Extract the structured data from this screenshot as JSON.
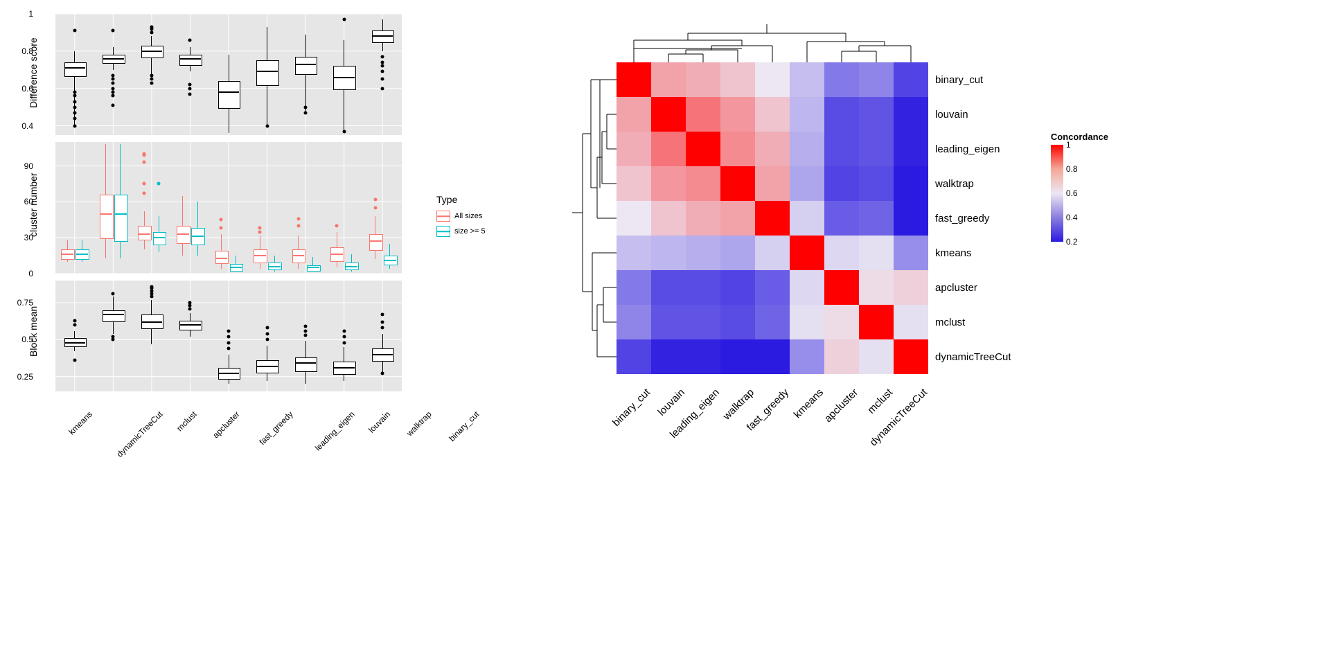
{
  "chart_data": [
    {
      "type": "boxplot",
      "ylabel": "Difference score",
      "ylim": [
        0.35,
        1.0
      ],
      "yticks": [
        0.4,
        0.6,
        0.8,
        1.0
      ],
      "categories": [
        "kmeans",
        "dynamicTreeCut",
        "mclust",
        "apcluster",
        "fast_greedy",
        "leading_eigen",
        "louvain",
        "walktrap",
        "binary_cut"
      ],
      "series": [
        {
          "name": "",
          "color": "#000",
          "stats": [
            {
              "min": 0.4,
              "q1": 0.67,
              "med": 0.71,
              "q3": 0.74,
              "max": 0.8,
              "out": [
                0.4,
                0.44,
                0.47,
                0.5,
                0.53,
                0.56,
                0.58,
                0.91
              ]
            },
            {
              "min": 0.7,
              "q1": 0.74,
              "med": 0.76,
              "q3": 0.78,
              "max": 0.82,
              "out": [
                0.51,
                0.56,
                0.58,
                0.6,
                0.63,
                0.65,
                0.67,
                0.91
              ]
            },
            {
              "min": 0.67,
              "q1": 0.77,
              "med": 0.8,
              "q3": 0.83,
              "max": 0.88,
              "out": [
                0.63,
                0.65,
                0.67,
                0.9,
                0.92,
                0.93
              ]
            },
            {
              "min": 0.69,
              "q1": 0.73,
              "med": 0.76,
              "q3": 0.78,
              "max": 0.82,
              "out": [
                0.57,
                0.6,
                0.62,
                0.86
              ]
            },
            {
              "min": 0.36,
              "q1": 0.5,
              "med": 0.58,
              "q3": 0.64,
              "max": 0.78,
              "out": []
            },
            {
              "min": 0.4,
              "q1": 0.62,
              "med": 0.69,
              "q3": 0.75,
              "max": 0.93,
              "out": [
                0.4
              ]
            },
            {
              "min": 0.47,
              "q1": 0.68,
              "med": 0.73,
              "q3": 0.77,
              "max": 0.89,
              "out": [
                0.47,
                0.5
              ]
            },
            {
              "min": 0.37,
              "q1": 0.6,
              "med": 0.66,
              "q3": 0.72,
              "max": 0.86,
              "out": [
                0.37,
                0.97
              ]
            },
            {
              "min": 0.8,
              "q1": 0.85,
              "med": 0.88,
              "q3": 0.91,
              "max": 0.97,
              "out": [
                0.6,
                0.65,
                0.69,
                0.72,
                0.74,
                0.77
              ]
            }
          ]
        }
      ]
    },
    {
      "type": "boxplot",
      "ylabel": "cluster number",
      "ylim": [
        0,
        110
      ],
      "yticks": [
        0,
        30,
        60,
        90
      ],
      "categories": [
        "kmeans",
        "dynamicTreeCut",
        "mclust",
        "apcluster",
        "fast_greedy",
        "leading_eigen",
        "louvain",
        "walktrap",
        "binary_cut"
      ],
      "legend_title": "Type",
      "series": [
        {
          "name": "All sizes",
          "color": "#F8766D",
          "stats": [
            {
              "min": 10,
              "q1": 13,
              "med": 16,
              "q3": 20,
              "max": 28,
              "out": []
            },
            {
              "min": 13,
              "q1": 30,
              "med": 50,
              "q3": 66,
              "max": 108,
              "out": []
            },
            {
              "min": 20,
              "q1": 29,
              "med": 33,
              "q3": 40,
              "max": 52,
              "out": [
                67,
                75,
                93,
                99,
                100
              ]
            },
            {
              "min": 15,
              "q1": 26,
              "med": 33,
              "q3": 40,
              "max": 65,
              "out": []
            },
            {
              "min": 4,
              "q1": 9,
              "med": 13,
              "q3": 19,
              "max": 33,
              "out": [
                38,
                45
              ]
            },
            {
              "min": 4,
              "q1": 10,
              "med": 15,
              "q3": 20,
              "max": 32,
              "out": [
                35,
                38
              ]
            },
            {
              "min": 4,
              "q1": 10,
              "med": 15,
              "q3": 20,
              "max": 32,
              "out": [
                40,
                46
              ]
            },
            {
              "min": 5,
              "q1": 11,
              "med": 16,
              "q3": 22,
              "max": 35,
              "out": [
                40
              ]
            },
            {
              "min": 12,
              "q1": 20,
              "med": 27,
              "q3": 33,
              "max": 48,
              "out": [
                55,
                62
              ]
            }
          ]
        },
        {
          "name": "size >= 5",
          "color": "#00BFC4",
          "stats": [
            {
              "min": 10,
              "q1": 13,
              "med": 16,
              "q3": 20,
              "max": 28,
              "out": []
            },
            {
              "min": 13,
              "q1": 28,
              "med": 50,
              "q3": 66,
              "max": 108,
              "out": []
            },
            {
              "min": 18,
              "q1": 25,
              "med": 30,
              "q3": 35,
              "max": 48,
              "out": [
                75
              ]
            },
            {
              "min": 15,
              "q1": 25,
              "med": 31,
              "q3": 38,
              "max": 60,
              "out": []
            },
            {
              "min": 2,
              "q1": 3,
              "med": 5,
              "q3": 8,
              "max": 15,
              "out": []
            },
            {
              "min": 2,
              "q1": 4,
              "med": 6,
              "q3": 9,
              "max": 15,
              "out": []
            },
            {
              "min": 2,
              "q1": 3,
              "med": 5,
              "q3": 7,
              "max": 14,
              "out": []
            },
            {
              "min": 2,
              "q1": 4,
              "med": 6,
              "q3": 9,
              "max": 16,
              "out": []
            },
            {
              "min": 4,
              "q1": 8,
              "med": 11,
              "q3": 15,
              "max": 25,
              "out": []
            }
          ]
        }
      ]
    },
    {
      "type": "boxplot",
      "ylabel": "Block mean",
      "ylim": [
        0.15,
        0.9
      ],
      "yticks": [
        0.25,
        0.5,
        0.75
      ],
      "categories": [
        "kmeans",
        "dynamicTreeCut",
        "mclust",
        "apcluster",
        "fast_greedy",
        "leading_eigen",
        "louvain",
        "walktrap",
        "binary_cut"
      ],
      "series": [
        {
          "name": "",
          "color": "#000",
          "stats": [
            {
              "min": 0.42,
              "q1": 0.46,
              "med": 0.48,
              "q3": 0.51,
              "max": 0.56,
              "out": [
                0.36,
                0.6,
                0.63
              ]
            },
            {
              "min": 0.54,
              "q1": 0.63,
              "med": 0.67,
              "q3": 0.7,
              "max": 0.79,
              "out": [
                0.5,
                0.52,
                0.81
              ]
            },
            {
              "min": 0.47,
              "q1": 0.58,
              "med": 0.62,
              "q3": 0.67,
              "max": 0.77,
              "out": [
                0.79,
                0.81,
                0.83,
                0.85,
                0.86
              ]
            },
            {
              "min": 0.52,
              "q1": 0.57,
              "med": 0.6,
              "q3": 0.63,
              "max": 0.68,
              "out": [
                0.71,
                0.73,
                0.75
              ]
            },
            {
              "min": 0.2,
              "q1": 0.24,
              "med": 0.27,
              "q3": 0.31,
              "max": 0.4,
              "out": [
                0.44,
                0.48,
                0.52,
                0.56
              ]
            },
            {
              "min": 0.22,
              "q1": 0.28,
              "med": 0.32,
              "q3": 0.36,
              "max": 0.46,
              "out": [
                0.5,
                0.54,
                0.58
              ]
            },
            {
              "min": 0.2,
              "q1": 0.29,
              "med": 0.34,
              "q3": 0.38,
              "max": 0.49,
              "out": [
                0.53,
                0.56,
                0.59
              ]
            },
            {
              "min": 0.22,
              "q1": 0.27,
              "med": 0.31,
              "q3": 0.35,
              "max": 0.45,
              "out": [
                0.48,
                0.52,
                0.56
              ]
            },
            {
              "min": 0.28,
              "q1": 0.36,
              "med": 0.4,
              "q3": 0.44,
              "max": 0.54,
              "out": [
                0.58,
                0.62,
                0.67,
                0.27
              ]
            }
          ]
        }
      ]
    },
    {
      "type": "heatmap",
      "title": "",
      "legend_title": "Concordance",
      "legend_ticks": [
        1,
        0.8,
        0.6,
        0.4,
        0.2
      ],
      "row_labels": [
        "binary_cut",
        "louvain",
        "leading_eigen",
        "walktrap",
        "fast_greedy",
        "kmeans",
        "apcluster",
        "mclust",
        "dynamicTreeCut"
      ],
      "col_labels": [
        "binary_cut",
        "louvain",
        "leading_eigen",
        "walktrap",
        "fast_greedy",
        "kmeans",
        "apcluster",
        "mclust",
        "dynamicTreeCut"
      ],
      "matrix": [
        [
          1.0,
          0.72,
          0.7,
          0.66,
          0.6,
          0.5,
          0.33,
          0.36,
          0.2
        ],
        [
          0.72,
          1.0,
          0.8,
          0.74,
          0.66,
          0.48,
          0.22,
          0.24,
          0.12
        ],
        [
          0.7,
          0.8,
          1.0,
          0.76,
          0.7,
          0.46,
          0.22,
          0.24,
          0.12
        ],
        [
          0.66,
          0.74,
          0.76,
          1.0,
          0.72,
          0.44,
          0.2,
          0.22,
          0.1
        ],
        [
          0.6,
          0.66,
          0.7,
          0.72,
          1.0,
          0.54,
          0.26,
          0.28,
          0.08
        ],
        [
          0.5,
          0.48,
          0.46,
          0.44,
          0.54,
          1.0,
          0.56,
          0.58,
          0.38
        ],
        [
          0.33,
          0.22,
          0.22,
          0.2,
          0.26,
          0.56,
          1.0,
          0.62,
          0.64
        ],
        [
          0.36,
          0.24,
          0.24,
          0.22,
          0.28,
          0.58,
          0.62,
          1.0,
          0.58
        ],
        [
          0.2,
          0.12,
          0.12,
          0.1,
          0.08,
          0.38,
          0.64,
          0.58,
          1.0
        ]
      ]
    }
  ],
  "legend": {
    "title": "Type",
    "items": [
      "All sizes",
      "size >= 5"
    ]
  },
  "concordance": {
    "title": "Concordance",
    "ticks": [
      "1",
      "0.8",
      "0.6",
      "0.4",
      "0.2"
    ]
  }
}
